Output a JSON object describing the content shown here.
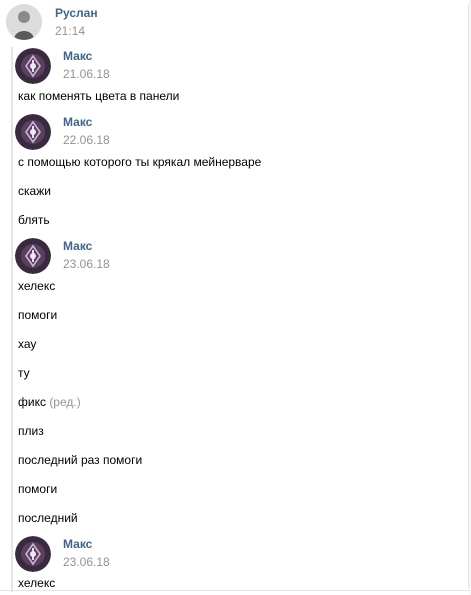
{
  "top": {
    "author": "Руслан",
    "time": "21:14"
  },
  "groups": [
    {
      "author": "Макс",
      "date": "21.06.18",
      "messages": [
        "как поменять цвета в панели"
      ]
    },
    {
      "author": "Макс",
      "date": "22.06.18",
      "messages": [
        "с помощью которого ты крякал мейнерваре",
        "скажи",
        "блять"
      ]
    },
    {
      "author": "Макс",
      "date": "23.06.18",
      "messages": [
        "хелекс",
        "помоги",
        "хау",
        "ту",
        "фикс",
        "плиз",
        "последний раз помоги",
        "помоги",
        "последний"
      ],
      "edited_label": "(ред.)"
    },
    {
      "author": "Макс",
      "date": "23.06.18",
      "messages": [
        "хелекс"
      ]
    }
  ],
  "colors": {
    "name": "#42648b",
    "meta": "#939393",
    "quote_bar": "#dfe6ef"
  }
}
